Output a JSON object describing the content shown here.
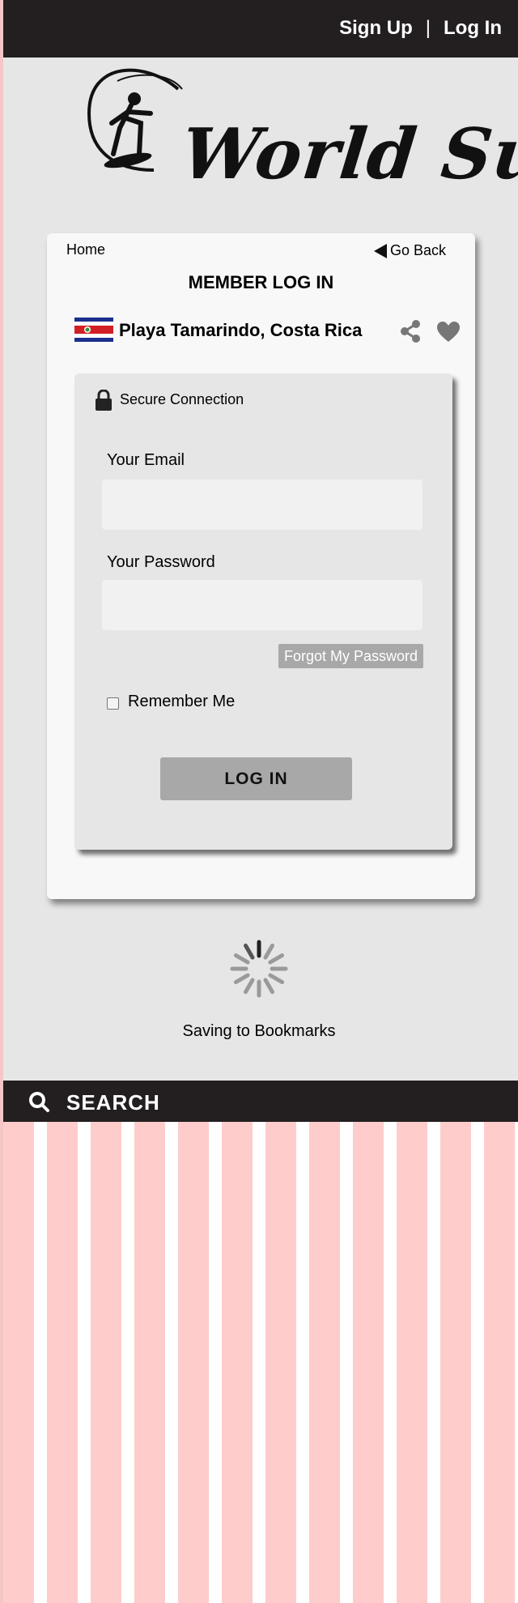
{
  "topbar": {
    "signup_label": "Sign Up",
    "separator": "|",
    "login_label": "Log In"
  },
  "brand": {
    "logo_text": "World Surf",
    "logo_icon": "surfer-wave-icon"
  },
  "card": {
    "home_label": "Home",
    "go_back_label": "Go Back",
    "title": "MEMBER LOG IN",
    "location": "Playa Tamarindo, Costa Rica",
    "flag_icon": "costa-rica-flag-icon",
    "share_icon": "share-icon",
    "heart_icon": "heart-icon"
  },
  "login_form": {
    "secure_label": "Secure Connection",
    "email_label": "Your Email",
    "email_value": "",
    "email_placeholder": "",
    "password_label": "Your Password",
    "password_value": "",
    "password_placeholder": "",
    "forgot_label": "Forgot My Password",
    "remember_label": "Remember Me",
    "remember_checked": false,
    "submit_label": "LOG IN"
  },
  "status": {
    "message": "Saving to Bookmarks",
    "spinner_icon": "loading-spinner-icon"
  },
  "search": {
    "label": "SEARCH",
    "icon": "search-icon"
  },
  "colors": {
    "dark_bar": "#231f20",
    "page_bg": "#e6e6e6",
    "button_gray": "#a8a8a9",
    "stripe_pink": "#ffcccc"
  }
}
